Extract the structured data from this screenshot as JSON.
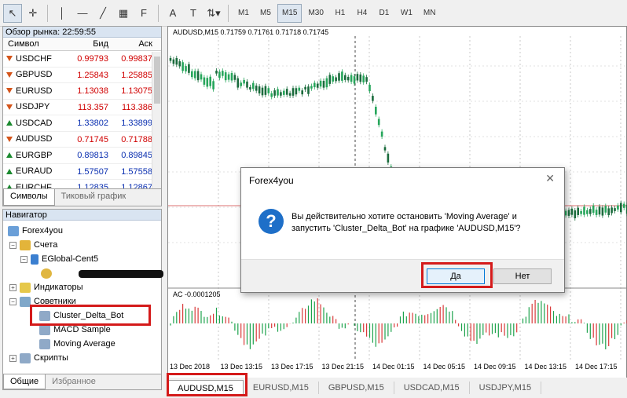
{
  "toolbar": {
    "timeframes": [
      "M1",
      "M5",
      "M15",
      "M30",
      "H1",
      "H4",
      "D1",
      "W1",
      "MN"
    ],
    "active_timeframe": "M15"
  },
  "market_watch": {
    "title": "Обзор рынка: 22:59:55",
    "col_symbol": "Символ",
    "col_bid": "Бид",
    "col_ask": "Аск",
    "rows": [
      {
        "symbol": "USDCHF",
        "bid": "0.99793",
        "ask": "0.99837",
        "dir": "down",
        "color": "red"
      },
      {
        "symbol": "GBPUSD",
        "bid": "1.25843",
        "ask": "1.25885",
        "dir": "down",
        "color": "red"
      },
      {
        "symbol": "EURUSD",
        "bid": "1.13038",
        "ask": "1.13075",
        "dir": "down",
        "color": "red"
      },
      {
        "symbol": "USDJPY",
        "bid": "113.357",
        "ask": "113.386",
        "dir": "down",
        "color": "red"
      },
      {
        "symbol": "USDCAD",
        "bid": "1.33802",
        "ask": "1.33899",
        "dir": "up",
        "color": "blue"
      },
      {
        "symbol": "AUDUSD",
        "bid": "0.71745",
        "ask": "0.71788",
        "dir": "down",
        "color": "red"
      },
      {
        "symbol": "EURGBP",
        "bid": "0.89813",
        "ask": "0.89845",
        "dir": "up",
        "color": "blue"
      },
      {
        "symbol": "EURAUD",
        "bid": "1.57507",
        "ask": "1.57558",
        "dir": "up",
        "color": "blue"
      },
      {
        "symbol": "EURCHF",
        "bid": "1.12835",
        "ask": "1.12867",
        "dir": "up",
        "color": "blue"
      }
    ],
    "tab_symbols": "Символы",
    "tab_tick": "Тиковый график"
  },
  "navigator": {
    "title": "Навигатор",
    "root": "Forex4you",
    "accounts": "Счета",
    "server": "EGlobal-Cent5",
    "indicators": "Индикаторы",
    "advisors": "Советники",
    "advisor_items": [
      "Cluster_Delta_Bot",
      "MACD Sample",
      "Moving Average"
    ],
    "scripts": "Скрипты",
    "tab_general": "Общие",
    "tab_favorites": "Избранное"
  },
  "chart": {
    "info": "AUDUSD,M15  0.71759 0.71761 0.71718 0.71745",
    "indicator_info": "AC -0.0001205",
    "x_labels": [
      "13 Dec 2018",
      "13 Dec 13:15",
      "13 Dec 17:15",
      "13 Dec 21:15",
      "14 Dec 01:15",
      "14 Dec 05:15",
      "14 Dec 09:15",
      "14 Dec 13:15",
      "14 Dec 17:15"
    ],
    "tabs": [
      "AUDUSD,M15",
      "EURUSD,M15",
      "GBPUSD,M15",
      "USDCAD,M15",
      "USDJPY,M15"
    ],
    "active_tab": "AUDUSD,M15"
  },
  "dialog": {
    "title": "Forex4you",
    "message": "Вы действительно хотите остановить 'Moving Average' и запустить 'Cluster_Delta_Bot' на графике 'AUDUSD,M15'?",
    "yes": "Да",
    "no": "Нет"
  },
  "colors": {
    "up": "#1b8a2f",
    "down": "#d4541a",
    "highlight": "#d41a1a",
    "dialog_accent": "#1e6fc8"
  }
}
